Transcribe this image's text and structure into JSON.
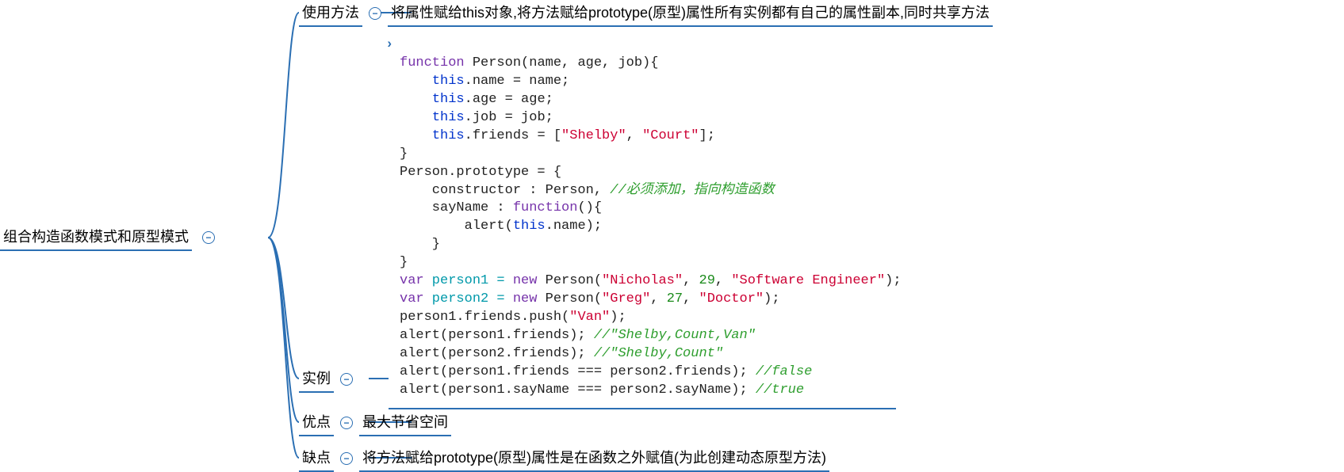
{
  "root": {
    "label": "组合构造函数模式和原型模式"
  },
  "usage": {
    "label": "使用方法",
    "desc": "将属性赋给this对象,将方法赋给prototype(原型)属性所有实例都有自己的属性副本,同时共享方法"
  },
  "example": {
    "label": "实例"
  },
  "advantage": {
    "label": "优点",
    "desc": "最大节省空间"
  },
  "disadvantage": {
    "label": "缺点",
    "desc": "将方法赋给prototype(原型)属性是在函数之外赋值(为此创建动态原型方法)"
  },
  "code": {
    "l1a": "function",
    "l1b": " Person(name, age, job){",
    "l2a": "this",
    "l2b": ".name = name;",
    "l3a": "this",
    "l3b": ".age = age;",
    "l4a": "this",
    "l4b": ".job = job;",
    "l5a": "this",
    "l5b": ".friends = [",
    "l5c": "\"Shelby\"",
    "l5d": ", ",
    "l5e": "\"Court\"",
    "l5f": "];",
    "l6": "}",
    "l7": "Person.prototype = {",
    "l8a": "    constructor : Person, ",
    "l8b": "//必须添加，指向构造函数",
    "l9a": "    sayName : ",
    "l9b": "function",
    "l9c": "(){",
    "l10a": "        alert(",
    "l10b": "this",
    "l10c": ".name);",
    "l11": "    }",
    "l12": "}",
    "l13a": "var",
    "l13b": " person1 = ",
    "l13c": "new",
    "l13d": " Person(",
    "l13e": "\"Nicholas\"",
    "l13f": ", ",
    "l13g": "29",
    "l13h": ", ",
    "l13i": "\"Software Engineer\"",
    "l13j": ");",
    "l14a": "var",
    "l14b": " person2 = ",
    "l14c": "new",
    "l14d": " Person(",
    "l14e": "\"Greg\"",
    "l14f": ", ",
    "l14g": "27",
    "l14h": ", ",
    "l14i": "\"Doctor\"",
    "l14j": ");",
    "l15a": "person1.friends.push(",
    "l15b": "\"Van\"",
    "l15c": ");",
    "l16a": "alert(person1.friends); ",
    "l16b": "//\"Shelby,Count,Van\"",
    "l17a": "alert(person2.friends); ",
    "l17b": "//\"Shelby,Count\"",
    "l18a": "alert(person1.friends === person2.friends); ",
    "l18b": "//false",
    "l19a": "alert(person1.sayName === person2.sayName); ",
    "l19b": "//true"
  },
  "collapse_glyph": "−"
}
